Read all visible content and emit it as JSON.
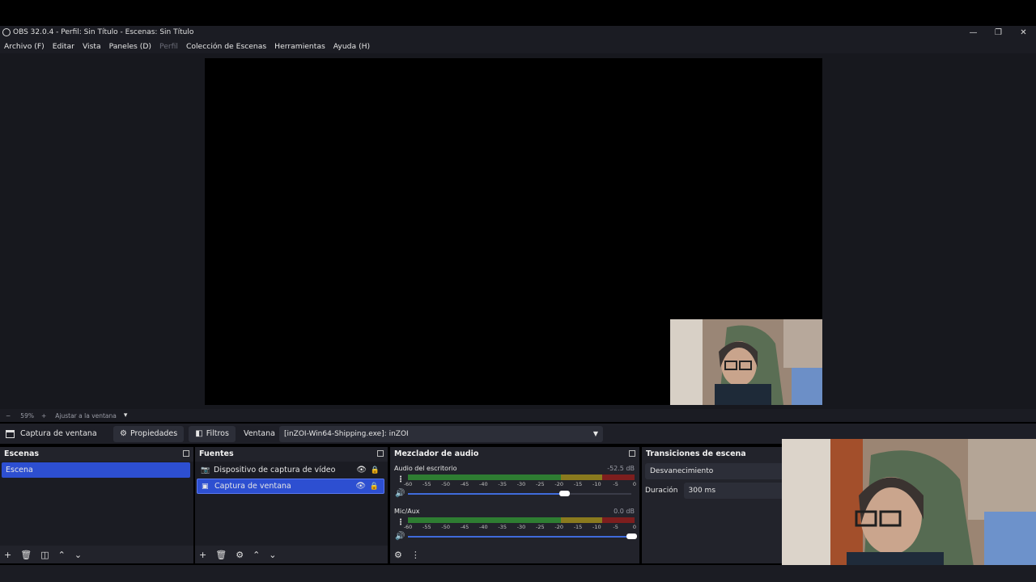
{
  "window": {
    "title": "OBS 32.0.4 - Perfil: Sin Título - Escenas: Sin Título",
    "controls": [
      "—",
      "❐",
      "✕"
    ]
  },
  "menu": {
    "items": [
      "Archivo (F)",
      "Editar",
      "Vista",
      "Paneles (D)",
      "Perfil",
      "Colección de Escenas",
      "Herramientas",
      "Ayuda (H)"
    ]
  },
  "zoom": {
    "minus": "−",
    "value": "59%",
    "plus": "+",
    "fit_label": "Ajustar a la ventana",
    "caret": "▾"
  },
  "properties_bar": {
    "source_name": "Captura de ventana",
    "properties_label": "Propiedades",
    "filters_label": "Filtros",
    "window_label": "Ventana",
    "window_value": "[inZOI-Win64-Shipping.exe]: inZOI"
  },
  "scenes": {
    "header": "Escenas",
    "items": [
      "Escena"
    ]
  },
  "sources": {
    "header": "Fuentes",
    "items": [
      {
        "label": "Dispositivo de captura de vídeo",
        "icon": "camera-icon"
      },
      {
        "label": "Captura de ventana",
        "icon": "window-icon"
      }
    ]
  },
  "mixer": {
    "header": "Mezclador de audio",
    "ticks": [
      "-60",
      "-55",
      "-50",
      "-45",
      "-40",
      "-35",
      "-30",
      "-25",
      "-20",
      "-15",
      "-10",
      "-5",
      "0"
    ],
    "channels": [
      {
        "name": "Audio del escritorio",
        "db": "-52.5 dB",
        "volume": 0.7
      },
      {
        "name": "Mic/Aux",
        "db": "0.0 dB",
        "volume": 1.0
      }
    ]
  },
  "transitions": {
    "header": "Transiciones de escena",
    "selected": "Desvanecimiento",
    "duration_label": "Duración",
    "duration_value": "300 ms"
  },
  "colors": {
    "accent": "#2d4fd1",
    "panel": "#22232b",
    "meter_green": "#2e7d32",
    "meter_yellow": "#8a7a1e",
    "meter_red": "#7d1e1e"
  }
}
